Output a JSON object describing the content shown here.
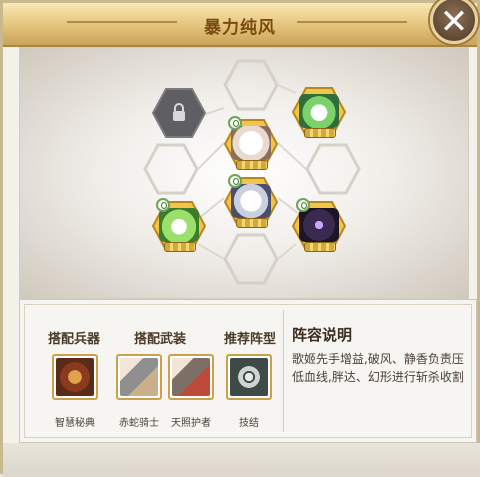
{
  "window": {
    "title": "暴力纯风",
    "close_label": "✕"
  },
  "formation": {
    "slots": [
      {
        "id": "top-center",
        "state": "empty"
      },
      {
        "id": "top-left",
        "state": "locked"
      },
      {
        "id": "top-right",
        "state": "hero",
        "hero": "green-cat"
      },
      {
        "id": "mid-left",
        "state": "empty"
      },
      {
        "id": "center-upper",
        "state": "hero",
        "hero": "white-cat"
      },
      {
        "id": "mid-right",
        "state": "empty"
      },
      {
        "id": "bottom-left",
        "state": "hero",
        "hero": "green-bird"
      },
      {
        "id": "center-lower",
        "state": "hero",
        "hero": "white-wolf"
      },
      {
        "id": "bottom-right",
        "state": "hero",
        "hero": "purple-spider"
      },
      {
        "id": "bottom-center",
        "state": "empty"
      }
    ]
  },
  "equipment": {
    "weapon_header": "搭配兵器",
    "armament_header": "搭配武装",
    "formation_header": "推荐阵型",
    "weapon": {
      "name": "智慧秘典",
      "icon": "book-icon"
    },
    "armaments": [
      {
        "name": "赤蛇骑士",
        "icon": "mech-knight-icon"
      },
      {
        "name": "天照护者",
        "icon": "guardian-mech-icon"
      }
    ],
    "recommended_formation": {
      "name": "技结",
      "icon": "formation-circle-icon"
    }
  },
  "lineup": {
    "title": "阵容说明",
    "description": "歌姬先手增益,破风、静香负责压低血线,胖达、幻形进行斩杀收割"
  },
  "colors": {
    "accent": "#c9a24a",
    "title_text": "#7a4a12",
    "hex_gold": "#d8ad3c"
  }
}
